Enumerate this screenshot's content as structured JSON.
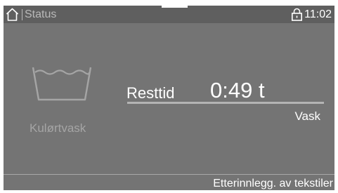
{
  "header": {
    "title": "Status",
    "time": "11:02",
    "home_icon": "home-icon",
    "lock_icon": "lock-icon"
  },
  "program": {
    "name": "Kulørtvask",
    "icon": "wash-tub-icon",
    "remaining_label": "Resttid",
    "remaining_time": "0:49 t",
    "phase": "Vask",
    "progress": 0
  },
  "footer": {
    "action_label": "Etterinnlegg. av tekstiler"
  },
  "colors": {
    "panel": "#747474",
    "topbar": "#5f5f5f",
    "text": "#ffffff",
    "muted_text": "#a5a5a5"
  }
}
